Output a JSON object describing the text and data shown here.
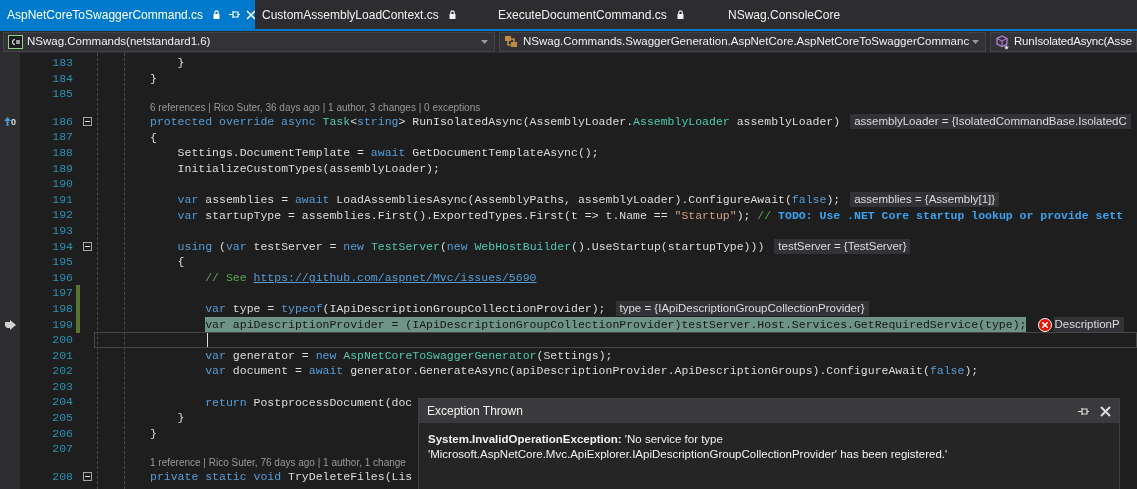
{
  "tabs": [
    {
      "label": "AspNetCoreToSwaggerCommand.cs",
      "selected": true,
      "locked": true
    },
    {
      "label": "CustomAssemblyLoadContext.cs",
      "selected": false,
      "locked": true
    },
    {
      "label": "ExecuteDocumentCommand.cs",
      "selected": false,
      "locked": true
    },
    {
      "label": "NSwag.ConsoleCore",
      "selected": false,
      "locked": false
    }
  ],
  "navigation_bar": [
    {
      "kind": "project",
      "text": "NSwag.Commands(netstandard1.6)"
    },
    {
      "kind": "class",
      "text": "NSwag.Commands.SwaggerGeneration.AspNetCore.AspNetCoreToSwaggerCommanc"
    },
    {
      "kind": "method",
      "text": "RunIsolatedAsync(Asse"
    }
  ],
  "editor": {
    "lines": [
      {
        "kind": "code",
        "number": "183",
        "changed": false,
        "foldable": false,
        "highlighted": false,
        "caret": false,
        "tokens": [
          {
            "kind": "plain",
            "text": "    }"
          }
        ]
      },
      {
        "kind": "code",
        "number": "184",
        "changed": false,
        "foldable": false,
        "highlighted": false,
        "caret": false,
        "tokens": [
          {
            "kind": "plain",
            "text": "}"
          }
        ]
      },
      {
        "kind": "code",
        "number": "185",
        "changed": false,
        "foldable": false,
        "highlighted": false,
        "caret": false
      },
      {
        "kind": "lens",
        "text": "6 references | Rico Suter, 36 days ago | 1 author, 3 changes | 0 exceptions"
      },
      {
        "kind": "code",
        "number": "186",
        "changed": false,
        "foldable": true,
        "highlighted": false,
        "caret": false,
        "gutter": {
          "kind": "references",
          "text": "0"
        },
        "datatip": "assemblyLoader = {IsolatedCommandBase.IsolatedC",
        "tokens": [
          {
            "kind": "keyword",
            "text": "protected override async "
          },
          {
            "kind": "type",
            "text": "Task"
          },
          {
            "kind": "plain",
            "text": "<"
          },
          {
            "kind": "keyword",
            "text": "string"
          },
          {
            "kind": "plain",
            "text": "> RunIsolatedAsync(AssemblyLoader."
          },
          {
            "kind": "type",
            "text": "AssemblyLoader"
          },
          {
            "kind": "plain",
            "text": " assemblyLoader)"
          }
        ]
      },
      {
        "kind": "code",
        "number": "187",
        "changed": false,
        "foldable": false,
        "highlighted": false,
        "caret": false,
        "tokens": [
          {
            "kind": "plain",
            "text": "{"
          }
        ]
      },
      {
        "kind": "code",
        "number": "188",
        "changed": false,
        "foldable": false,
        "highlighted": false,
        "caret": false,
        "tokens": [
          {
            "kind": "plain",
            "text": "    Settings.DocumentTemplate = "
          },
          {
            "kind": "keyword",
            "text": "await"
          },
          {
            "kind": "plain",
            "text": " GetDocumentTemplateAsync();"
          }
        ]
      },
      {
        "kind": "code",
        "number": "189",
        "changed": false,
        "foldable": false,
        "highlighted": false,
        "caret": false,
        "tokens": [
          {
            "kind": "plain",
            "text": "    InitializeCustomTypes(assemblyLoader);"
          }
        ]
      },
      {
        "kind": "code",
        "number": "190",
        "changed": false,
        "foldable": false,
        "highlighted": false,
        "caret": false
      },
      {
        "kind": "code",
        "number": "191",
        "changed": false,
        "foldable": false,
        "highlighted": false,
        "caret": false,
        "datatip": "assemblies = {Assembly[1]}",
        "tokens": [
          {
            "kind": "keyword",
            "text": "    var"
          },
          {
            "kind": "plain",
            "text": " assemblies = "
          },
          {
            "kind": "keyword",
            "text": "await"
          },
          {
            "kind": "plain",
            "text": " LoadAssembliesAsync(AssemblyPaths, assemblyLoader).ConfigureAwait("
          },
          {
            "kind": "keyword",
            "text": "false"
          },
          {
            "kind": "plain",
            "text": ");"
          }
        ]
      },
      {
        "kind": "code",
        "number": "192",
        "changed": false,
        "foldable": false,
        "highlighted": false,
        "caret": false,
        "tokens": [
          {
            "kind": "keyword",
            "text": "    var"
          },
          {
            "kind": "plain",
            "text": " startupType = assemblies.First().ExportedTypes.First(t => t.Name == "
          },
          {
            "kind": "string",
            "text": "\"Startup\""
          },
          {
            "kind": "plain",
            "text": "); "
          },
          {
            "kind": "comment",
            "text": "// "
          },
          {
            "kind": "todo",
            "text": "TODO: Use .NET Core startup lookup or provide sett"
          }
        ]
      },
      {
        "kind": "code",
        "number": "193",
        "changed": false,
        "foldable": false,
        "highlighted": false,
        "caret": false
      },
      {
        "kind": "code",
        "number": "194",
        "changed": false,
        "foldable": true,
        "highlighted": false,
        "caret": false,
        "datatip": "testServer = {TestServer}",
        "tokens": [
          {
            "kind": "keyword",
            "text": "    using"
          },
          {
            "kind": "plain",
            "text": " ("
          },
          {
            "kind": "keyword",
            "text": "var"
          },
          {
            "kind": "plain",
            "text": " testServer = "
          },
          {
            "kind": "keyword",
            "text": "new"
          },
          {
            "kind": "type",
            "text": " TestServer"
          },
          {
            "kind": "plain",
            "text": "("
          },
          {
            "kind": "keyword",
            "text": "new"
          },
          {
            "kind": "type",
            "text": " WebHostBuilder"
          },
          {
            "kind": "plain",
            "text": "().UseStartup(startupType)))"
          }
        ]
      },
      {
        "kind": "code",
        "number": "195",
        "changed": false,
        "foldable": false,
        "highlighted": false,
        "caret": false,
        "tokens": [
          {
            "kind": "plain",
            "text": "    {"
          }
        ]
      },
      {
        "kind": "code",
        "number": "196",
        "changed": false,
        "foldable": false,
        "highlighted": false,
        "caret": false,
        "tokens": [
          {
            "kind": "comment",
            "text": "        // See "
          },
          {
            "kind": "url",
            "text": "https://github.com/aspnet/Mvc/issues/5690"
          }
        ]
      },
      {
        "kind": "code",
        "number": "197",
        "changed": true,
        "foldable": false,
        "highlighted": false,
        "caret": false
      },
      {
        "kind": "code",
        "number": "198",
        "changed": true,
        "foldable": false,
        "highlighted": false,
        "caret": false,
        "datatip": "type = {IApiDescriptionGroupCollectionProvider}",
        "tokens": [
          {
            "kind": "keyword",
            "text": "        var"
          },
          {
            "kind": "plain",
            "text": " type = "
          },
          {
            "kind": "keyword",
            "text": "typeof"
          },
          {
            "kind": "plain",
            "text": "(IApiDescriptionGroupCollectionProvider);"
          }
        ]
      },
      {
        "kind": "code",
        "number": "199",
        "changed": true,
        "foldable": false,
        "highlighted": true,
        "caret": false,
        "gutter": {
          "kind": "current-statement"
        },
        "error_tip": "DescriptionP",
        "tokens": [
          {
            "kind": "keyword",
            "text": "        var"
          },
          {
            "kind": "plain",
            "text": " apiDescriptionProvider = (IApiDescriptionGroupCollectionProvider)testServer.Host.Services.GetRequiredService(type);"
          }
        ]
      },
      {
        "kind": "code",
        "number": "200",
        "changed": false,
        "foldable": false,
        "highlighted": false,
        "caret": true
      },
      {
        "kind": "code",
        "number": "201",
        "changed": false,
        "foldable": false,
        "highlighted": false,
        "caret": false,
        "tokens": [
          {
            "kind": "keyword",
            "text": "        var"
          },
          {
            "kind": "plain",
            "text": " generator = "
          },
          {
            "kind": "keyword",
            "text": "new"
          },
          {
            "kind": "type",
            "text": " AspNetCoreToSwaggerGenerator"
          },
          {
            "kind": "plain",
            "text": "(Settings);"
          }
        ]
      },
      {
        "kind": "code",
        "number": "202",
        "changed": false,
        "foldable": false,
        "highlighted": false,
        "caret": false,
        "tokens": [
          {
            "kind": "keyword",
            "text": "        var"
          },
          {
            "kind": "plain",
            "text": " document = "
          },
          {
            "kind": "keyword",
            "text": "await"
          },
          {
            "kind": "plain",
            "text": " generator.GenerateAsync(apiDescriptionProvider.ApiDescriptionGroups).ConfigureAwait("
          },
          {
            "kind": "keyword",
            "text": "false"
          },
          {
            "kind": "plain",
            "text": ");"
          }
        ]
      },
      {
        "kind": "code",
        "number": "203",
        "changed": false,
        "foldable": false,
        "highlighted": false,
        "caret": false
      },
      {
        "kind": "code",
        "number": "204",
        "changed": false,
        "foldable": false,
        "highlighted": false,
        "caret": false,
        "tokens": [
          {
            "kind": "keyword",
            "text": "        return"
          },
          {
            "kind": "plain",
            "text": " PostprocessDocument(doc"
          }
        ]
      },
      {
        "kind": "code",
        "number": "205",
        "changed": false,
        "foldable": false,
        "highlighted": false,
        "caret": false,
        "tokens": [
          {
            "kind": "plain",
            "text": "    }"
          }
        ]
      },
      {
        "kind": "code",
        "number": "206",
        "changed": false,
        "foldable": false,
        "highlighted": false,
        "caret": false,
        "tokens": [
          {
            "kind": "plain",
            "text": "}"
          }
        ]
      },
      {
        "kind": "code",
        "number": "207",
        "changed": false,
        "foldable": false,
        "highlighted": false,
        "caret": false
      },
      {
        "kind": "lens",
        "text": "1 reference | Rico Suter, 76 days ago | 1 author, 1 change"
      },
      {
        "kind": "code",
        "number": "208",
        "changed": false,
        "foldable": true,
        "highlighted": false,
        "caret": false,
        "tokens": [
          {
            "kind": "keyword",
            "text": "private static void"
          },
          {
            "kind": "plain",
            "text": " TryDeleteFiles(Lis"
          }
        ]
      }
    ]
  },
  "exception_popup": {
    "title": "Exception Thrown",
    "message": "**System.InvalidOperationException:** 'No service for type\n'Microsoft.AspNetCore.Mvc.ApiExplorer.IApiDescriptionGroupCollectionProvider' has been registered.'"
  }
}
